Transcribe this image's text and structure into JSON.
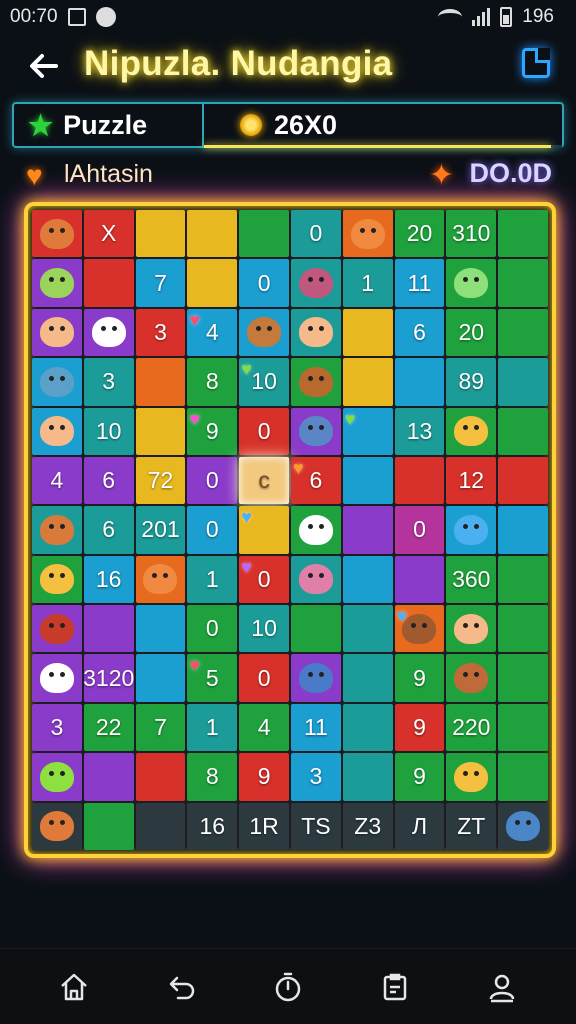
{
  "status": {
    "time": "00:70",
    "battery": "196"
  },
  "appbar": {
    "title": "Nipuzla. Nudangia"
  },
  "infobar": {
    "mode_label": "Puzzle",
    "score": "26X0",
    "progress": 0.97
  },
  "subhead": {
    "player": "lAhtasin",
    "timer": "DO.0D"
  },
  "board": {
    "rows": [
      [
        {
          "t": "",
          "c": "red",
          "m": "#e07a3a"
        },
        {
          "t": "X",
          "c": "red"
        },
        {
          "t": "",
          "c": "yellow"
        },
        {
          "t": "",
          "c": "yellow"
        },
        {
          "t": "",
          "c": "green"
        },
        {
          "t": "0",
          "c": "teal"
        },
        {
          "t": "",
          "c": "orange",
          "m": "#f08a40"
        },
        {
          "t": "20",
          "c": "green"
        },
        {
          "t": "310",
          "c": "green"
        },
        {
          "t": "",
          "c": "green"
        }
      ],
      [
        {
          "t": "",
          "c": "purple",
          "m": "#9bd45a"
        },
        {
          "t": "",
          "c": "red"
        },
        {
          "t": "7",
          "c": "blue"
        },
        {
          "t": "",
          "c": "yellow"
        },
        {
          "t": "0",
          "c": "blue"
        },
        {
          "t": "",
          "c": "teal",
          "m": "#c0577e"
        },
        {
          "t": "1",
          "c": "teal"
        },
        {
          "t": "11",
          "c": "blue"
        },
        {
          "t": "",
          "c": "green",
          "m": "#8ee07a"
        },
        {
          "t": "",
          "c": "green"
        }
      ],
      [
        {
          "t": "",
          "c": "purple",
          "m": "#f5b98a"
        },
        {
          "t": "",
          "c": "purple",
          "m": "#ffffff"
        },
        {
          "t": "3",
          "c": "red"
        },
        {
          "t": "4",
          "c": "blue"
        },
        {
          "t": "",
          "c": "blue",
          "m": "#c47a3a"
        },
        {
          "t": "",
          "c": "teal",
          "m": "#f5b98a"
        },
        {
          "t": "",
          "c": "yellow"
        },
        {
          "t": "6",
          "c": "blue"
        },
        {
          "t": "20",
          "c": "green"
        },
        {
          "t": "",
          "c": "green"
        }
      ],
      [
        {
          "t": "",
          "c": "blue",
          "m": "#5aa0c8"
        },
        {
          "t": "3",
          "c": "teal"
        },
        {
          "t": "",
          "c": "orange"
        },
        {
          "t": "8",
          "c": "green"
        },
        {
          "t": "10",
          "c": "teal"
        },
        {
          "t": "",
          "c": "green",
          "m": "#b86a2e"
        },
        {
          "t": "",
          "c": "yellow"
        },
        {
          "t": "",
          "c": "blue"
        },
        {
          "t": "89",
          "c": "teal"
        },
        {
          "t": "",
          "c": "teal"
        }
      ],
      [
        {
          "t": "",
          "c": "blue",
          "m": "#f5b98a"
        },
        {
          "t": "10",
          "c": "teal"
        },
        {
          "t": "",
          "c": "yellow"
        },
        {
          "t": "9",
          "c": "green"
        },
        {
          "t": "0",
          "c": "red"
        },
        {
          "t": "",
          "c": "purple",
          "m": "#5a86c8"
        },
        {
          "t": "",
          "c": "blue"
        },
        {
          "t": "13",
          "c": "teal"
        },
        {
          "t": "",
          "c": "green",
          "m": "#f5c040"
        },
        {
          "t": "",
          "c": "green"
        }
      ],
      [
        {
          "t": "4",
          "c": "purple"
        },
        {
          "t": "6",
          "c": "purple"
        },
        {
          "t": "72",
          "c": "yellow"
        },
        {
          "t": "0",
          "c": "purple"
        },
        {
          "t": "c",
          "c": "light",
          "sel": true
        },
        {
          "t": "6",
          "c": "red"
        },
        {
          "t": "",
          "c": "blue"
        },
        {
          "t": "",
          "c": "red"
        },
        {
          "t": "12",
          "c": "red"
        },
        {
          "t": "",
          "c": "red"
        }
      ],
      [
        {
          "t": "",
          "c": "teal",
          "m": "#d87a3a"
        },
        {
          "t": "6",
          "c": "teal"
        },
        {
          "t": "201",
          "c": "teal"
        },
        {
          "t": "0",
          "c": "blue"
        },
        {
          "t": "",
          "c": "yellow"
        },
        {
          "t": "",
          "c": "green",
          "m": "#ffffff"
        },
        {
          "t": "",
          "c": "purple"
        },
        {
          "t": "0",
          "c": "magenta"
        },
        {
          "t": "",
          "c": "blue",
          "m": "#4ab0f0"
        },
        {
          "t": "",
          "c": "blue"
        }
      ],
      [
        {
          "t": "",
          "c": "green",
          "m": "#f5c040"
        },
        {
          "t": "16",
          "c": "blue"
        },
        {
          "t": "",
          "c": "orange",
          "m": "#f08a40"
        },
        {
          "t": "1",
          "c": "teal"
        },
        {
          "t": "0",
          "c": "red"
        },
        {
          "t": "",
          "c": "teal",
          "m": "#e080a8"
        },
        {
          "t": "",
          "c": "blue"
        },
        {
          "t": "",
          "c": "purple"
        },
        {
          "t": "360",
          "c": "green"
        },
        {
          "t": "",
          "c": "green"
        }
      ],
      [
        {
          "t": "",
          "c": "purple",
          "m": "#c83a2a"
        },
        {
          "t": "",
          "c": "purple"
        },
        {
          "t": "",
          "c": "blue"
        },
        {
          "t": "0",
          "c": "green"
        },
        {
          "t": "10",
          "c": "teal"
        },
        {
          "t": "",
          "c": "green"
        },
        {
          "t": "",
          "c": "teal"
        },
        {
          "t": "",
          "c": "orange",
          "m": "#a05a2e"
        },
        {
          "t": "",
          "c": "green",
          "m": "#f5b98a"
        },
        {
          "t": "",
          "c": "green"
        }
      ],
      [
        {
          "t": "",
          "c": "purple",
          "m": "#ffffff"
        },
        {
          "t": "3120",
          "c": "purple"
        },
        {
          "t": "",
          "c": "blue"
        },
        {
          "t": "5",
          "c": "green"
        },
        {
          "t": "0",
          "c": "red"
        },
        {
          "t": "",
          "c": "purple",
          "m": "#4a7ac8"
        },
        {
          "t": "",
          "c": "teal"
        },
        {
          "t": "9",
          "c": "green"
        },
        {
          "t": "",
          "c": "green",
          "m": "#c06a3a"
        },
        {
          "t": "",
          "c": "green"
        }
      ],
      [
        {
          "t": "3",
          "c": "purple"
        },
        {
          "t": "22",
          "c": "green"
        },
        {
          "t": "7",
          "c": "green"
        },
        {
          "t": "1",
          "c": "teal"
        },
        {
          "t": "4",
          "c": "green"
        },
        {
          "t": "11",
          "c": "blue"
        },
        {
          "t": "",
          "c": "teal"
        },
        {
          "t": "9",
          "c": "red"
        },
        {
          "t": "220",
          "c": "green"
        },
        {
          "t": "",
          "c": "green"
        }
      ],
      [
        {
          "t": "",
          "c": "purple",
          "m": "#8ee040"
        },
        {
          "t": "",
          "c": "purple"
        },
        {
          "t": "",
          "c": "red"
        },
        {
          "t": "8",
          "c": "green"
        },
        {
          "t": "9",
          "c": "red"
        },
        {
          "t": "3",
          "c": "blue"
        },
        {
          "t": "",
          "c": "teal"
        },
        {
          "t": "9",
          "c": "green"
        },
        {
          "t": "",
          "c": "green",
          "m": "#f5c040"
        },
        {
          "t": "",
          "c": "green"
        }
      ],
      [
        {
          "t": "",
          "c": "dark",
          "m": "#e07a3a"
        },
        {
          "t": "",
          "c": "green"
        },
        {
          "t": "",
          "c": "dark"
        },
        {
          "t": "16",
          "c": "dark"
        },
        {
          "t": "1R",
          "c": "dark"
        },
        {
          "t": "TS",
          "c": "dark"
        },
        {
          "t": "Z3",
          "c": "dark"
        },
        {
          "t": "Л",
          "c": "dark"
        },
        {
          "t": "ZT",
          "c": "dark"
        },
        {
          "t": "",
          "c": "dark",
          "m": "#4a86c8"
        }
      ]
    ]
  },
  "hearts": [
    {
      "ch": "♥",
      "color": "#ff4b6e"
    },
    {
      "ch": "♥",
      "color": "#ff9a2a"
    },
    {
      "ch": "♥",
      "color": "#7fe040"
    },
    {
      "ch": "♥",
      "color": "#ff4bd0"
    },
    {
      "ch": "♥",
      "color": "#4ab0ff"
    },
    {
      "ch": "♥",
      "color": "#b06aff"
    },
    {
      "ch": "♥",
      "color": "#ff4b6e"
    },
    {
      "ch": "♥",
      "color": "#7fe040"
    },
    {
      "ch": "♥",
      "color": "#4ab0ff"
    }
  ],
  "nav": [
    {
      "name": "home",
      "icon": "home-icon"
    },
    {
      "name": "undo",
      "icon": "undo-icon"
    },
    {
      "name": "timer",
      "icon": "stopwatch-icon"
    },
    {
      "name": "tasks",
      "icon": "clipboard-icon"
    },
    {
      "name": "profile",
      "icon": "user-icon"
    }
  ],
  "colors": {
    "accent": "#f6e03b",
    "board_border": "#ffd23a",
    "infobar_border": "#2ea4b8"
  }
}
